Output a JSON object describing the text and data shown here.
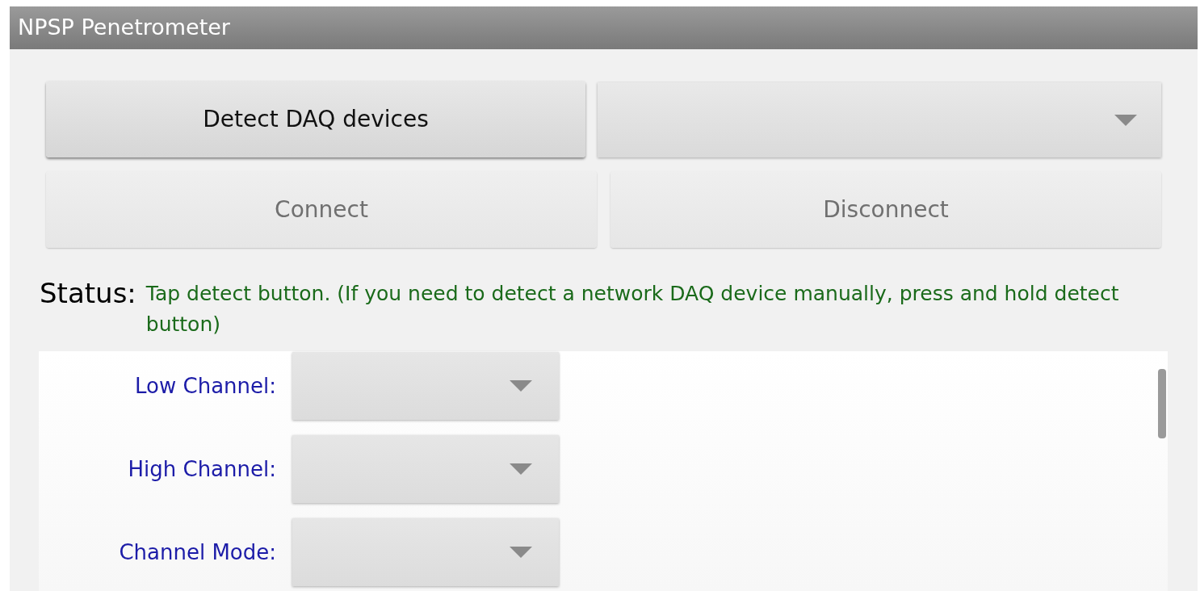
{
  "window": {
    "title": "NPSP Penetrometer"
  },
  "buttons": [
    {
      "label": "Detect DAQ devices",
      "disabled": false
    },
    {
      "label": "Connect",
      "disabled": true
    },
    {
      "label": "Disconnect",
      "disabled": true
    }
  ],
  "status": {
    "label": "Status:",
    "message": "Tap detect button. (If you need to detect a network DAQ device manually, press and hold detect button)"
  },
  "settings": [
    {
      "label": "Low Channel:"
    },
    {
      "label": "High Channel:"
    },
    {
      "label": "Channel Mode:"
    }
  ]
}
